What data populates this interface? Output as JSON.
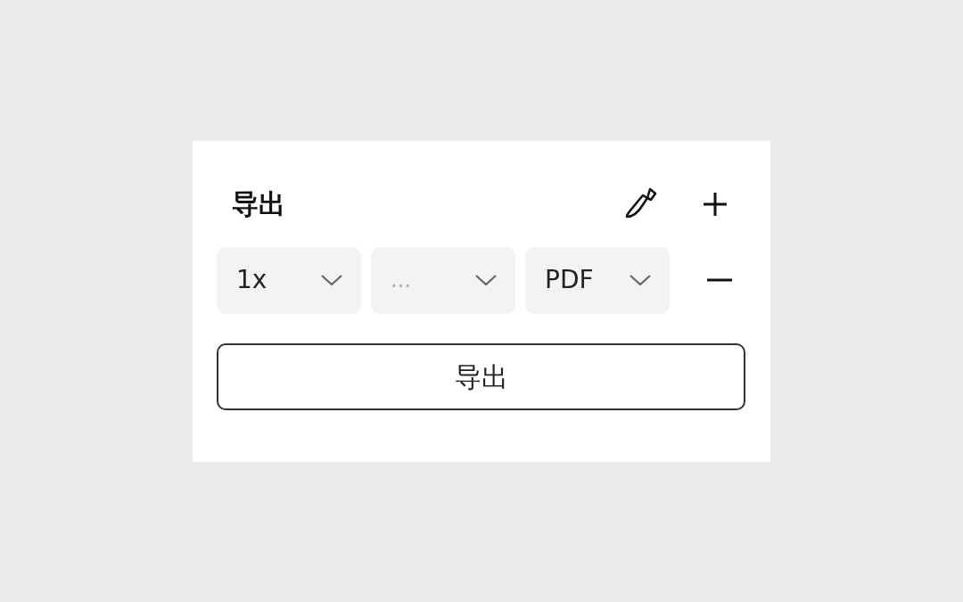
{
  "panel": {
    "title": "导出",
    "settings": [
      {
        "value": "1x"
      },
      {
        "placeholder": "..."
      },
      {
        "value": "PDF"
      }
    ],
    "export_button": "导出"
  }
}
